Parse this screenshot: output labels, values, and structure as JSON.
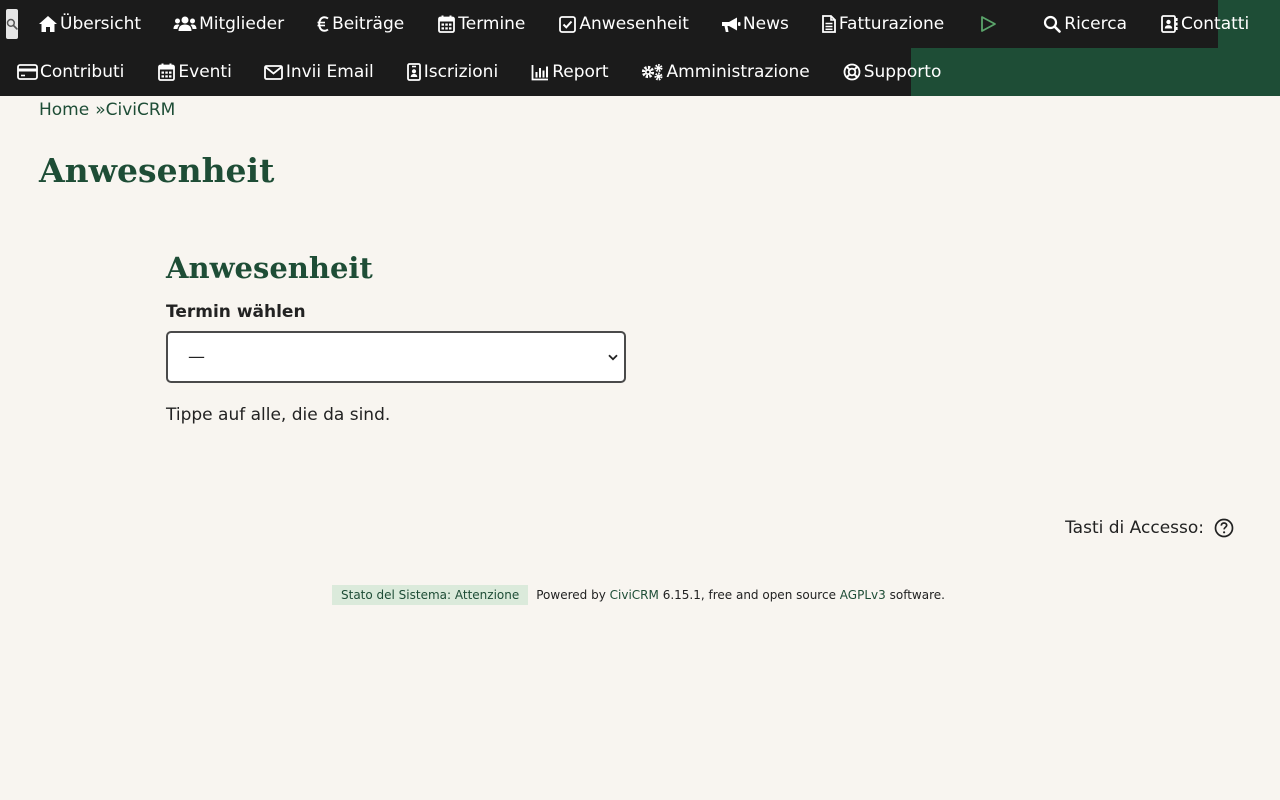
{
  "menu": {
    "row1": [
      {
        "label": "Übersicht",
        "icon": "home-icon"
      },
      {
        "label": "Mitglieder",
        "icon": "users-icon"
      },
      {
        "label": "Beiträge",
        "icon": "euro-icon"
      },
      {
        "label": "Termine",
        "icon": "calendar-icon"
      },
      {
        "label": "Anwesenheit",
        "icon": "check-square-icon"
      },
      {
        "label": "News",
        "icon": "megaphone-icon"
      },
      {
        "label": "Fatturazione",
        "icon": "file-icon"
      },
      {
        "label": "",
        "icon": "play-icon"
      },
      {
        "label": "Ricerca",
        "icon": "search-icon"
      },
      {
        "label": "Contatti",
        "icon": "address-book-icon"
      }
    ],
    "row2": [
      {
        "label": "Contributi",
        "icon": "credit-card-icon"
      },
      {
        "label": "Eventi",
        "icon": "calendar-icon"
      },
      {
        "label": "Invii Email",
        "icon": "envelope-icon"
      },
      {
        "label": "Iscrizioni",
        "icon": "id-badge-icon"
      },
      {
        "label": "Report",
        "icon": "bar-chart-icon"
      },
      {
        "label": "Amministrazione",
        "icon": "gears-icon"
      },
      {
        "label": "Supporto",
        "icon": "lifebuoy-icon"
      }
    ]
  },
  "breadcrumb": {
    "home": "Home",
    "separator": "»",
    "current": "CiviCRM"
  },
  "page_title": "Anwesenheit",
  "form": {
    "title": "Anwesenheit",
    "select_label": "Termin wählen",
    "select_value": "—",
    "hint": "Tippe auf alle, die da sind."
  },
  "access_keys": {
    "label": "Tasti di Accesso:"
  },
  "footer": {
    "status": "Stato del Sistema: Attenzione",
    "powered_prefix": "Powered by",
    "civicrm": "CiviCRM",
    "version_text": "6.15.1, free and open source",
    "license": "AGPLv3",
    "suffix": "software."
  },
  "colors": {
    "menu_bg": "#1b1b1b",
    "brand_green": "#1e4d36",
    "page_bg": "#f8f5f0",
    "status_badge_bg": "#dbeadb"
  }
}
